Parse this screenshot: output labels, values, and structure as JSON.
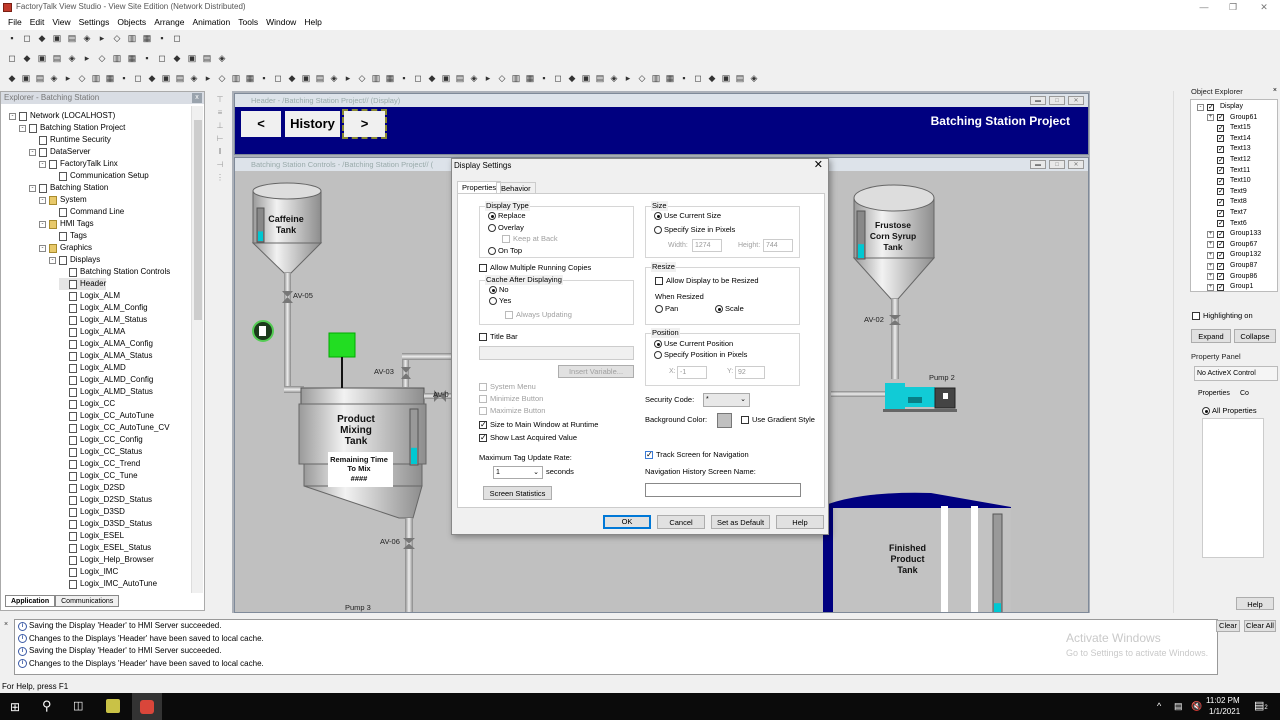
{
  "app": {
    "title": "FactoryTalk View Studio - View Site Edition (Network Distributed)",
    "menu": [
      "File",
      "Edit",
      "View",
      "Settings",
      "Objects",
      "Arrange",
      "Animation",
      "Tools",
      "Window",
      "Help"
    ]
  },
  "toolbars": {
    "row1": [
      "new-icon",
      "save-icon",
      "print-icon",
      "blank-icon",
      "copy-icon",
      "explorer-icon",
      "stop-icon",
      "record-icon",
      "display-icon",
      "run-icon",
      "test-icon",
      "grid-icon"
    ],
    "row2": [
      "arrow-icon",
      "select-icon",
      "cut-icon",
      "copy-icon",
      "paste-icon",
      "undo-icon",
      "redo-icon",
      "align-icon",
      "group-icon",
      "ungroup-icon",
      "zoom-in-icon",
      "zoom-out-icon",
      "front-icon",
      "back-icon",
      "grid-icon"
    ],
    "row3": [
      "select-icon",
      "rotate-icon",
      "text-icon",
      "freehand-icon",
      "rectangle-icon",
      "rounded-rect-icon",
      "circle-icon",
      "polyline-icon",
      "arc-icon",
      "line-icon",
      "polygon-icon",
      "wedge-icon",
      "image-icon",
      "panel-icon",
      "button-icon",
      "numeric-display-icon",
      "string-icon",
      "indicator-icon",
      "gauge-icon",
      "graph-icon",
      "slider-icon",
      "scale-icon",
      "trend-icon",
      "alarm-icon",
      "list-icon",
      "arrow-left-icon",
      "arrow-right-icon",
      "goto-icon",
      "close-icon",
      "display-list-icon",
      "print-icon",
      "key-icon",
      "up-icon",
      "down-icon",
      "home-icon",
      "end-icon",
      "page-up-icon",
      "page-down-icon",
      "backspace-icon",
      "enter-icon",
      "ack-icon",
      "silence-icon",
      "reset-icon",
      "sort-icon",
      "activex-icon",
      "browser-icon",
      "symbol-icon",
      "recipe-icon",
      "control-list-icon",
      "piloted-icon",
      "multistate-icon",
      "interlock-icon",
      "tag-icon",
      "pencil-icon"
    ]
  },
  "explorer": {
    "title": "Explorer - Batching Station",
    "tree": [
      {
        "label": "Network (LOCALHOST)",
        "level": 0,
        "icon": "network-icon",
        "exp": "-"
      },
      {
        "label": "Batching Station Project",
        "level": 1,
        "icon": "project-icon",
        "exp": "-"
      },
      {
        "label": "Runtime Security",
        "level": 2,
        "icon": "key-icon",
        "exp": ""
      },
      {
        "label": "DataServer",
        "level": 2,
        "icon": "data-server-icon",
        "exp": "-"
      },
      {
        "label": "FactoryTalk Linx",
        "level": 3,
        "icon": "linx-icon",
        "exp": "-"
      },
      {
        "label": "Communication Setup",
        "level": 4,
        "icon": "communication-icon",
        "exp": ""
      },
      {
        "label": "Batching Station",
        "level": 2,
        "icon": "hmi-server-icon",
        "exp": "-"
      },
      {
        "label": "System",
        "level": 3,
        "icon": "folder-icon",
        "exp": "-"
      },
      {
        "label": "Command Line",
        "level": 4,
        "icon": "command-line-icon",
        "exp": ""
      },
      {
        "label": "HMI Tags",
        "level": 3,
        "icon": "folder-icon",
        "exp": "-"
      },
      {
        "label": "Tags",
        "level": 4,
        "icon": "tags-icon",
        "exp": ""
      },
      {
        "label": "Graphics",
        "level": 3,
        "icon": "folder-icon",
        "exp": "-"
      },
      {
        "label": "Displays",
        "level": 4,
        "icon": "displays-icon",
        "exp": "-"
      },
      {
        "label": "Batching Station Controls",
        "level": 5,
        "icon": "display-file-icon",
        "exp": ""
      },
      {
        "label": "Header",
        "level": 5,
        "icon": "display-file-icon",
        "exp": "",
        "selected": true
      },
      {
        "label": "Logix_ALM",
        "level": 5,
        "icon": "display-file-icon",
        "exp": ""
      },
      {
        "label": "Logix_ALM_Config",
        "level": 5,
        "icon": "display-file-icon",
        "exp": ""
      },
      {
        "label": "Logix_ALM_Status",
        "level": 5,
        "icon": "display-file-icon",
        "exp": ""
      },
      {
        "label": "Logix_ALMA",
        "level": 5,
        "icon": "display-file-icon",
        "exp": ""
      },
      {
        "label": "Logix_ALMA_Config",
        "level": 5,
        "icon": "display-file-icon",
        "exp": ""
      },
      {
        "label": "Logix_ALMA_Status",
        "level": 5,
        "icon": "display-file-icon",
        "exp": ""
      },
      {
        "label": "Logix_ALMD",
        "level": 5,
        "icon": "display-file-icon",
        "exp": ""
      },
      {
        "label": "Logix_ALMD_Config",
        "level": 5,
        "icon": "display-file-icon",
        "exp": ""
      },
      {
        "label": "Logix_ALMD_Status",
        "level": 5,
        "icon": "display-file-icon",
        "exp": ""
      },
      {
        "label": "Logix_CC",
        "level": 5,
        "icon": "display-file-icon",
        "exp": ""
      },
      {
        "label": "Logix_CC_AutoTune",
        "level": 5,
        "icon": "display-file-icon",
        "exp": ""
      },
      {
        "label": "Logix_CC_AutoTune_CV",
        "level": 5,
        "icon": "display-file-icon",
        "exp": ""
      },
      {
        "label": "Logix_CC_Config",
        "level": 5,
        "icon": "display-file-icon",
        "exp": ""
      },
      {
        "label": "Logix_CC_Status",
        "level": 5,
        "icon": "display-file-icon",
        "exp": ""
      },
      {
        "label": "Logix_CC_Trend",
        "level": 5,
        "icon": "display-file-icon",
        "exp": ""
      },
      {
        "label": "Logix_CC_Tune",
        "level": 5,
        "icon": "display-file-icon",
        "exp": ""
      },
      {
        "label": "Logix_D2SD",
        "level": 5,
        "icon": "display-file-icon",
        "exp": ""
      },
      {
        "label": "Logix_D2SD_Status",
        "level": 5,
        "icon": "display-file-icon",
        "exp": ""
      },
      {
        "label": "Logix_D3SD",
        "level": 5,
        "icon": "display-file-icon",
        "exp": ""
      },
      {
        "label": "Logix_D3SD_Status",
        "level": 5,
        "icon": "display-file-icon",
        "exp": ""
      },
      {
        "label": "Logix_ESEL",
        "level": 5,
        "icon": "display-file-icon",
        "exp": ""
      },
      {
        "label": "Logix_ESEL_Status",
        "level": 5,
        "icon": "display-file-icon",
        "exp": ""
      },
      {
        "label": "Logix_Help_Browser",
        "level": 5,
        "icon": "display-file-icon",
        "exp": ""
      },
      {
        "label": "Logix_IMC",
        "level": 5,
        "icon": "display-file-icon",
        "exp": ""
      },
      {
        "label": "Logix_IMC_AutoTune",
        "level": 5,
        "icon": "display-file-icon",
        "exp": ""
      }
    ],
    "tabs": [
      "Application",
      "Communications"
    ]
  },
  "header_window": {
    "title": "Header - /Batching Station Project// (Display)",
    "back_label": "<",
    "history_label": "History",
    "forward_label": ">",
    "project_title": "Batching Station Project",
    "background": "#000080"
  },
  "controls_window": {
    "title": "Batching Station Controls - /Batching Station Project// (",
    "caffeine_tank": "Caffeine Tank",
    "caffeine_level": 0.3,
    "mixing_tank": "Product Mixing Tank",
    "mixing_level": 0.3,
    "remaining": "Remaining Time To Mix",
    "remaining_value": "####",
    "fcs_tank": "Frustose Corn Syrup Tank",
    "fcs_level": 0.3,
    "finished_tank": "Finished Product Tank",
    "finished_level": 0.1,
    "valves": {
      "av05": "AV-05",
      "av03": "AV-03",
      "av0": "AV-0",
      "av06": "AV-06",
      "av02": "AV-02"
    },
    "pump2": "Pump 2",
    "pump3": "Pump 3",
    "accent_cyan": "#00c8d2",
    "motor_green": "#22dd22"
  },
  "dialog": {
    "title": "Display Settings",
    "tabs": [
      "Properties",
      "Behavior"
    ],
    "display_type": {
      "label": "Display Type",
      "replace": "Replace",
      "overlay": "Overlay",
      "keep_at_back": "Keep at Back",
      "on_top": "On Top",
      "selected": "Replace"
    },
    "allow_multiple": {
      "label": "Allow Multiple Running Copies",
      "checked": false
    },
    "cache": {
      "label": "Cache After Displaying",
      "no": "No",
      "yes": "Yes",
      "always_updating": "Always Updating",
      "selected": "No"
    },
    "title_bar": {
      "label": "Title Bar",
      "checked": false,
      "value": ""
    },
    "insert_variable": "Insert Variable...",
    "system_menu": "System Menu",
    "minimize_button": "Minimize Button",
    "maximize_button": "Maximize Button",
    "size_to_main": {
      "label": "Size to Main Window at Runtime",
      "checked": true
    },
    "show_last": {
      "label": "Show Last Acquired Value",
      "checked": true
    },
    "max_rate": {
      "label": "Maximum Tag Update Rate:",
      "value": "1",
      "unit": "seconds"
    },
    "screen_statistics": "Screen Statistics",
    "size": {
      "label": "Size",
      "use_current": "Use Current Size",
      "specify": "Specify Size in Pixels",
      "width_label": "Width:",
      "width": "1274",
      "height_label": "Height:",
      "height": "744"
    },
    "resize": {
      "label": "Resize",
      "allow": "Allow Display to be Resized",
      "when_resized": "When Resized",
      "pan": "Pan",
      "scale": "Scale",
      "selected": "Scale"
    },
    "position": {
      "label": "Position",
      "use_current": "Use Current Position",
      "specify": "Specify Position in Pixels",
      "x_label": "X:",
      "x": "-1",
      "y_label": "Y:",
      "y": "92"
    },
    "security_code": {
      "label": "Security Code:",
      "value": "*"
    },
    "background_color": {
      "label": "Background Color:",
      "value": "#c0c0c0",
      "gradient": "Use Gradient Style"
    },
    "track_screen": {
      "label": "Track Screen for Navigation",
      "checked": true
    },
    "nav_history": {
      "label": "Navigation History Screen Name:",
      "value": ""
    },
    "buttons": {
      "ok": "OK",
      "cancel": "Cancel",
      "set_default": "Set as Default",
      "help": "Help"
    }
  },
  "object_explorer": {
    "title": "Object Explorer",
    "items": [
      {
        "label": "Display",
        "exp": "-",
        "level": 0
      },
      {
        "label": "Group61",
        "exp": "+",
        "level": 1
      },
      {
        "label": "Text15",
        "exp": "",
        "level": 1
      },
      {
        "label": "Text14",
        "exp": "",
        "level": 1
      },
      {
        "label": "Text13",
        "exp": "",
        "level": 1
      },
      {
        "label": "Text12",
        "exp": "",
        "level": 1
      },
      {
        "label": "Text11",
        "exp": "",
        "level": 1
      },
      {
        "label": "Text10",
        "exp": "",
        "level": 1
      },
      {
        "label": "Text9",
        "exp": "",
        "level": 1
      },
      {
        "label": "Text8",
        "exp": "",
        "level": 1
      },
      {
        "label": "Text7",
        "exp": "",
        "level": 1
      },
      {
        "label": "Text6",
        "exp": "",
        "level": 1
      },
      {
        "label": "Group133",
        "exp": "+",
        "level": 1
      },
      {
        "label": "Group67",
        "exp": "+",
        "level": 1
      },
      {
        "label": "Group132",
        "exp": "+",
        "level": 1
      },
      {
        "label": "Group87",
        "exp": "+",
        "level": 1
      },
      {
        "label": "Group86",
        "exp": "+",
        "level": 1
      },
      {
        "label": "Group1",
        "exp": "+",
        "level": 1
      }
    ],
    "highlighting": "Highlighting on",
    "expand": "Expand",
    "collapse": "Collapse"
  },
  "property_panel": {
    "title": "Property Panel",
    "control": "No ActiveX Control",
    "tabs": [
      "Properties",
      "Co"
    ],
    "all_properties": "All Properties",
    "help": "Help"
  },
  "output": {
    "messages": [
      "Saving the Display 'Header' to HMI Server succeeded.",
      "Changes to the Displays 'Header' have been saved to local cache.",
      "Saving the Display 'Header' to HMI Server succeeded.",
      "Changes to the Displays 'Header' have been saved to local cache."
    ],
    "clear": "Clear",
    "clear_all": "Clear All",
    "watermark_title": "Activate Windows",
    "watermark_sub": "Go to Settings to activate Windows."
  },
  "status": "For Help, press F1",
  "taskbar": {
    "time": "11:02 PM",
    "date": "1/1/2021",
    "notifications": "2"
  }
}
